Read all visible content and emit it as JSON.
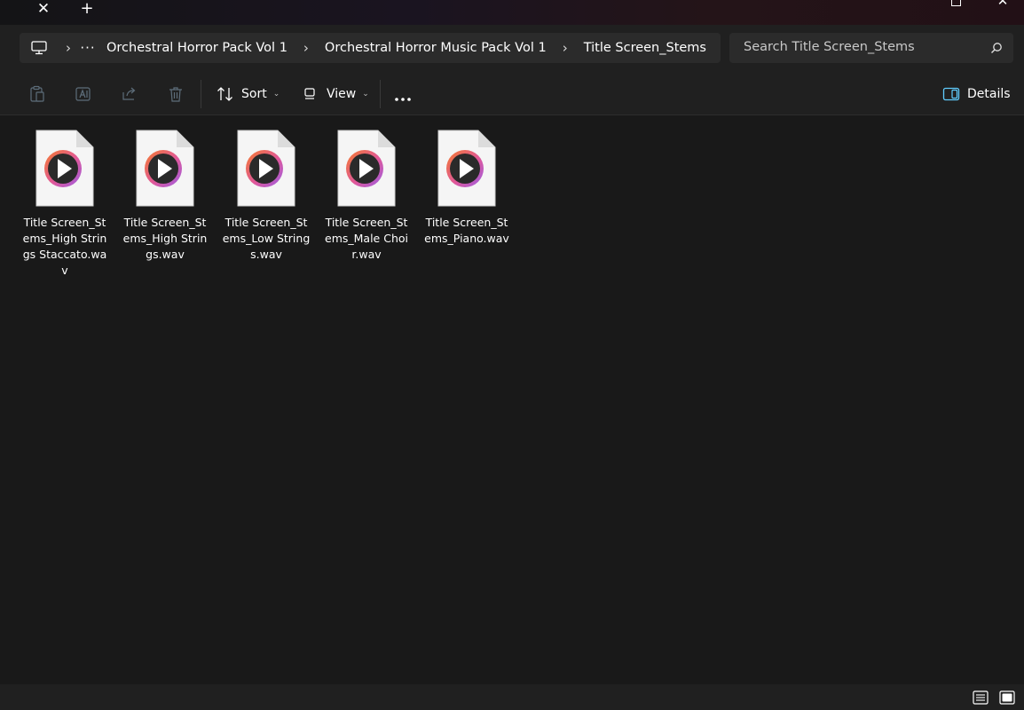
{
  "window": {
    "tab_close_glyph": "✕",
    "tab_new_glyph": "+",
    "close_glyph": "✕"
  },
  "address": {
    "pc_icon": "monitor-icon",
    "more_glyph": "···",
    "separator_glyph": "›",
    "crumbs": [
      "Orchestral Horror Pack Vol 1",
      "Orchestral Horror Music Pack Vol 1",
      "Title Screen_Stems"
    ]
  },
  "search": {
    "placeholder": "Search Title Screen_Stems",
    "icon": "search-icon"
  },
  "toolbar": {
    "sort_label": "Sort",
    "view_label": "View",
    "details_label": "Details",
    "caret_glyph": "⌄",
    "icons": [
      "clipboard-icon",
      "rename-icon",
      "share-icon",
      "delete-icon",
      "sort-icon",
      "view-icon",
      "more-icon",
      "details-pane-icon"
    ]
  },
  "files": [
    {
      "name": "Title Screen_Stems_High Strings Staccato.wav"
    },
    {
      "name": "Title Screen_Stems_High Strings.wav"
    },
    {
      "name": "Title Screen_Stems_Low Strings.wav"
    },
    {
      "name": "Title Screen_Stems_Male Choir.wav"
    },
    {
      "name": "Title Screen_Stems_Piano.wav"
    }
  ],
  "colors": {
    "background": "#191919",
    "panel": "#202020",
    "field": "#2b2b2b",
    "details_accent": "#60cdff",
    "media_ring_orange": "#f47a2c",
    "media_ring_purple": "#9b5de5"
  }
}
